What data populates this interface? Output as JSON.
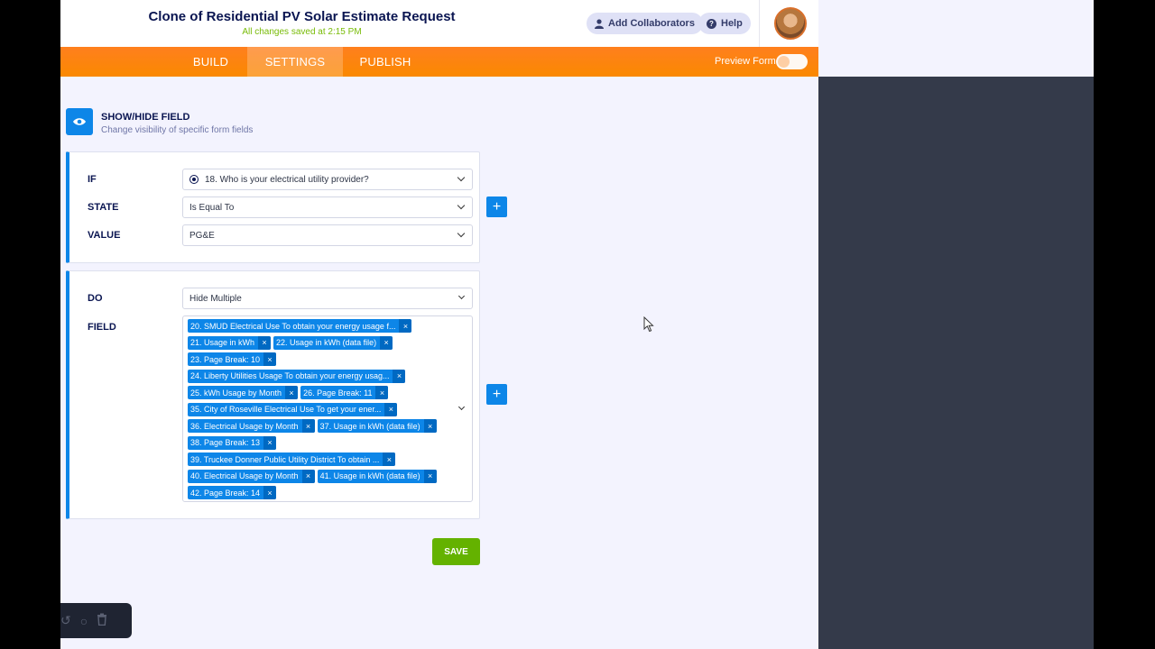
{
  "header": {
    "title": "Clone of Residential PV Solar Estimate Request",
    "saved_status": "All changes saved at 2:15 PM",
    "add_collaborators": "Add Collaborators",
    "help": "Help"
  },
  "nav": {
    "tabs": [
      "BUILD",
      "SETTINGS",
      "PUBLISH"
    ],
    "active_tab": "SETTINGS",
    "preview_label": "Preview Form",
    "preview_enabled": false
  },
  "section": {
    "title": "SHOW/HIDE FIELD",
    "subtitle": "Change visibility of specific form fields"
  },
  "condition": {
    "if_label": "IF",
    "if_value": "18. Who is your electrical utility provider?",
    "state_label": "STATE",
    "state_value": "Is Equal To",
    "value_label": "VALUE",
    "value_value": "PG&E"
  },
  "action": {
    "do_label": "DO",
    "do_value": "Hide Multiple",
    "field_label": "FIELD",
    "tag_rows": [
      [
        "20. SMUD Electrical Use To obtain your energy usage f..."
      ],
      [
        "21. Usage in kWh",
        "22. Usage in kWh (data file)"
      ],
      [
        "23. Page Break: 10"
      ],
      [
        "24. Liberty Utilities Usage To obtain your energy usag..."
      ],
      [
        "25. kWh Usage by Month",
        "26. Page Break: 11"
      ],
      [
        "35. City of Roseville Electrical Use To get your ener..."
      ],
      [
        "36. Electrical Usage by Month",
        "37. Usage in kWh (data file)"
      ],
      [
        "38. Page Break: 13"
      ],
      [
        "39. Truckee Donner Public Utility District To obtain ..."
      ],
      [
        "40. Electrical Usage by Month",
        "41. Usage in kWh (data file)"
      ],
      [
        "42. Page Break: 14"
      ]
    ]
  },
  "buttons": {
    "save": "SAVE",
    "add_symbol": "+",
    "remove_symbol": "×"
  },
  "colors": {
    "accent": "#0d86e8",
    "nav_orange": "#ff8200",
    "save_green": "#64b200",
    "saved_text": "#78bb07"
  }
}
